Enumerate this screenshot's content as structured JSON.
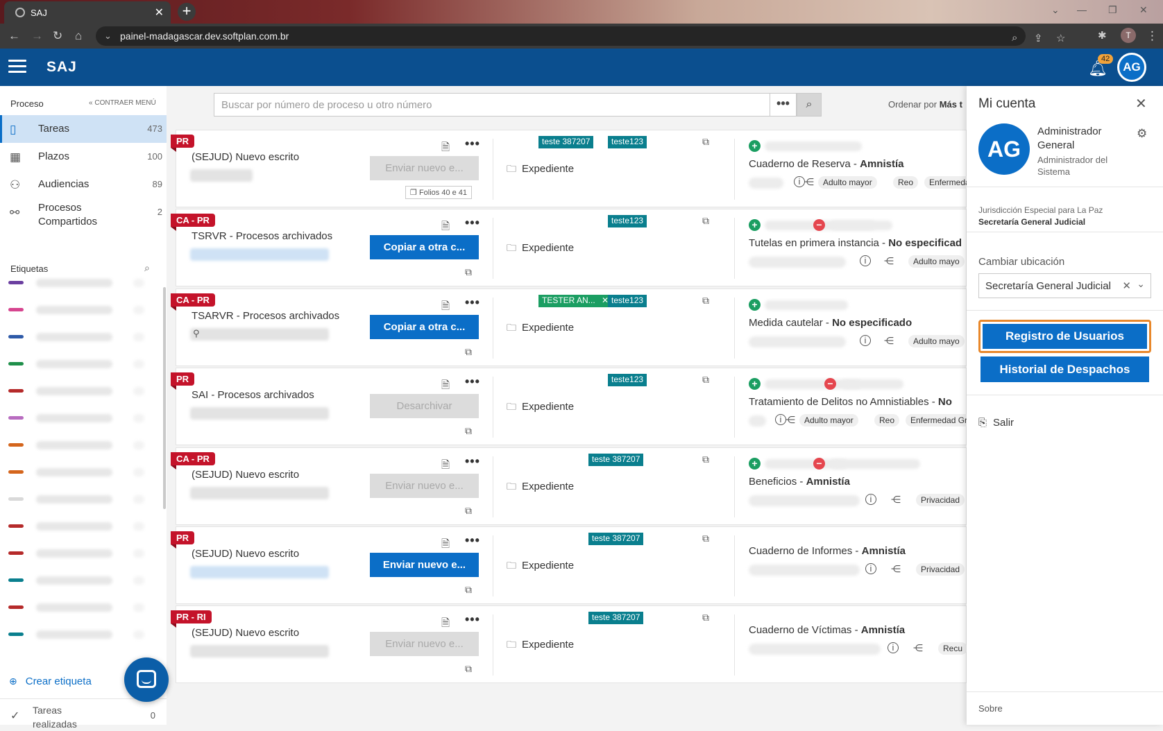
{
  "browser": {
    "tab_title": "SAJ",
    "url": "painel-madagascar.dev.softplan.com.br",
    "profile_initial": "T"
  },
  "header": {
    "app_name": "SAJ",
    "notification_count": "42",
    "avatar_initials": "AG"
  },
  "sidebar": {
    "section_title": "Proceso",
    "collapse_label": "CONTRAER MENÚ",
    "items": [
      {
        "label": "Tareas",
        "count": "473",
        "icon": "book-icon"
      },
      {
        "label": "Plazos",
        "count": "100",
        "icon": "calendar-icon"
      },
      {
        "label": "Audiencias",
        "count": "89",
        "icon": "people-icon"
      },
      {
        "label": "Procesos Compartidos",
        "count": "2",
        "icon": "share-users-icon"
      }
    ],
    "tags_title": "Etiquetas",
    "tag_colors": [
      "#6b3fa0",
      "#d6458f",
      "#2e5aa8",
      "#1f8f4a",
      "#b52a2a",
      "#b86cc0",
      "#d4651c",
      "#d4651c",
      "#d9d9d9",
      "#b52a2a",
      "#b52a2a",
      "#0a7f8e",
      "#b52a2a",
      "#0a7f8e"
    ],
    "create_tag_label": "Crear etiqueta",
    "done_tasks_label": "Tareas realizadas",
    "done_tasks_count": "0"
  },
  "search": {
    "placeholder": "Buscar por número de proceso u otro número",
    "more_label": "•••",
    "order_label": "Ordenar por",
    "order_value": "Más t"
  },
  "cards": [
    {
      "flag": "PR",
      "title": "(SEJUD) Nuevo escrito",
      "action": "Enviar nuevo e...",
      "action_state": "disabled",
      "folios": "Folios 40 e 41",
      "expediente": "Expediente",
      "tags": [
        "teste 387207",
        "teste123"
      ],
      "class_name": "Cuaderno de Reserva",
      "class_type": "Amnistía",
      "pills": [
        "Adulto mayor",
        "Reo",
        "Enfermedad"
      ]
    },
    {
      "flag": "CA - PR",
      "title": "TSRVR - Procesos archivados",
      "action": "Copiar a otra c...",
      "action_state": "primary",
      "expediente": "Expediente",
      "tags": [
        "teste123"
      ],
      "class_name": "Tutelas en primera instancia",
      "class_type": "No especificad",
      "pills": [
        "Adulto mayo"
      ]
    },
    {
      "flag": "CA - PR",
      "title": "TSARVR - Procesos archivados",
      "action": "Copiar a otra c...",
      "action_state": "primary",
      "expediente": "Expediente",
      "tags": [
        "TESTER AN...",
        "teste123"
      ],
      "class_name": "Medida cautelar",
      "class_type": "No especificado",
      "pills": [
        "Adulto mayo"
      ]
    },
    {
      "flag": "PR",
      "title": "SAI - Procesos archivados",
      "action": "Desarchivar",
      "action_state": "disabled",
      "expediente": "Expediente",
      "tags": [
        "teste123"
      ],
      "class_name": "Tratamiento de Delitos no Amnistiables",
      "class_type": "No",
      "pills": [
        "Adulto mayor",
        "Reo",
        "Enfermedad Grave"
      ]
    },
    {
      "flag": "CA - PR",
      "title": "(SEJUD) Nuevo escrito",
      "action": "Enviar nuevo e...",
      "action_state": "disabled",
      "expediente": "Expediente",
      "tags": [
        "teste 387207"
      ],
      "class_name": "Beneficios",
      "class_type": "Amnistía",
      "pills": [
        "Privacidad"
      ]
    },
    {
      "flag": "PR",
      "title": "(SEJUD) Nuevo escrito",
      "action": "Enviar nuevo e...",
      "action_state": "primary",
      "expediente": "Expediente",
      "tags": [
        "teste 387207"
      ],
      "class_name": "Cuaderno de Informes",
      "class_type": "Amnistía",
      "pills": [
        "Privacidad"
      ]
    },
    {
      "flag": "PR - RI",
      "title": "(SEJUD) Nuevo escrito",
      "action": "Enviar nuevo e...",
      "action_state": "disabled",
      "expediente": "Expediente",
      "tags": [
        "teste 387207"
      ],
      "class_name": "Cuaderno de Víctimas",
      "class_type": "Amnistía",
      "pills": [
        "Recu"
      ]
    }
  ],
  "account_panel": {
    "title": "Mi cuenta",
    "avatar_initials": "AG",
    "user_name": "Administrador General",
    "user_role": "Administrador del Sistema",
    "jurisdiction": "Jurisdicción Especial para La Paz",
    "office": "Secretaría General Judicial",
    "change_location_label": "Cambiar ubicación",
    "location_value": "Secretaría General Judicial",
    "register_users_label": "Registro de Usuarios",
    "history_label": "Historial de Despachos",
    "logout_label": "Salir",
    "about_label": "Sobre"
  },
  "colors": {
    "brand_blue": "#0b4f8f",
    "primary": "#0b6ec7",
    "flag_red": "#c4132a",
    "tag_teal": "#0a7f8e",
    "highlight_orange": "#e8872a"
  }
}
